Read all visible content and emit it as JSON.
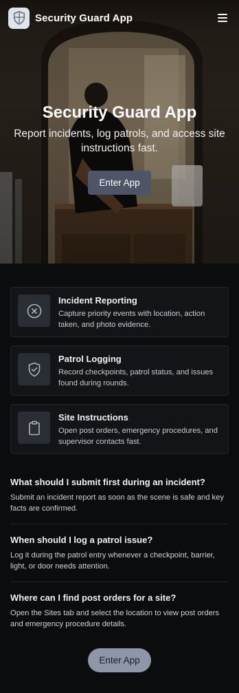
{
  "header": {
    "app_name": "Security Guard App",
    "logo_icon": "shield-icon",
    "menu_icon": "hamburger-menu-icon"
  },
  "hero": {
    "title": "Security Guard App",
    "subtitle": "Report incidents, log patrols, and access site instructions fast.",
    "cta_label": "Enter App"
  },
  "features": [
    {
      "icon": "x-circle-icon",
      "title": "Incident Reporting",
      "description": "Capture priority events with location, action taken, and photo evidence."
    },
    {
      "icon": "shield-check-icon",
      "title": "Patrol Logging",
      "description": "Record checkpoints, patrol status, and issues found during rounds."
    },
    {
      "icon": "clipboard-icon",
      "title": "Site Instructions",
      "description": "Open post orders, emergency procedures, and supervisor contacts fast."
    }
  ],
  "faq": [
    {
      "question": "What should I submit first during an incident?",
      "answer": "Submit an incident report as soon as the scene is safe and key facts are confirmed."
    },
    {
      "question": "When should I log a patrol issue?",
      "answer": "Log it during the patrol entry whenever a checkpoint, barrier, light, or door needs attention."
    },
    {
      "question": "Where can I find post orders for a site?",
      "answer": "Open the Sites tab and select the location to view post orders and emergency procedure details."
    }
  ],
  "footer": {
    "cta_label": "Enter App"
  },
  "colors": {
    "page_background": "#0b0c0e",
    "card_background": "#121417",
    "hero_button": "#4d5566",
    "bottom_button": "#8e97a8"
  }
}
